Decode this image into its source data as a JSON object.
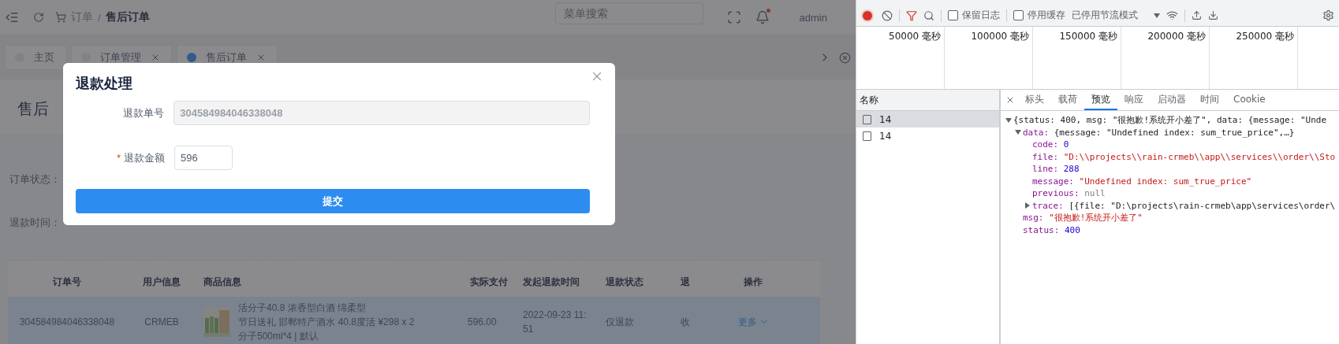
{
  "header": {
    "breadcrumb": [
      "订单",
      "售后订单"
    ],
    "breadcrumb_separator": "/",
    "search": {
      "placeholder": "菜单搜索"
    },
    "user": "admin",
    "bell_badge": true
  },
  "tabs": [
    {
      "label": "主页",
      "closable": false,
      "selected": false
    },
    {
      "label": "订单管理",
      "closable": true,
      "selected": false
    },
    {
      "label": "售后订单",
      "closable": true,
      "selected": true
    }
  ],
  "page": {
    "title": "售后",
    "filters": [
      {
        "label": "订单状态："
      },
      {
        "label": "退款时间："
      }
    ]
  },
  "table": {
    "columns": [
      "订单号",
      "用户信息",
      "商品信息",
      "实际支付",
      "发起退款时间",
      "退款状态",
      "退",
      "操作"
    ],
    "rows": [
      {
        "order_no": "304584984046338048",
        "user": "CRMEB",
        "product": {
          "kind": "picture",
          "lines": [
            "活分子40.8 浓香型白酒 绵柔型",
            "节日送礼 邯郸特产酒水 40.8度活",
            "分子500ml*4 | 默认"
          ],
          "price": "¥298 x 2"
        },
        "paid": "596.00",
        "time": "2022-09-23 11:51",
        "refund_status": "仅退款",
        "column_7": "收",
        "action": "更多",
        "selected": true
      }
    ]
  },
  "modal": {
    "title": "退款处理",
    "required_mark": "*",
    "fields": [
      {
        "label": "退款单号",
        "value": "304584984046338048",
        "disabled": true,
        "required": false
      },
      {
        "label": "退款金额",
        "value": "596",
        "disabled": false,
        "required": true
      }
    ],
    "submit": "提交"
  },
  "devtools": {
    "recording": true,
    "toolbar": {
      "preserve_log": {
        "label": "保留日志",
        "checked": false
      },
      "disable_cache": {
        "label": "停用缓存",
        "checked": false
      },
      "throttle": "已停用节流模式"
    },
    "timeline": [
      "50000 毫秒",
      "100000 毫秒",
      "150000 毫秒",
      "200000 毫秒",
      "250000 毫秒"
    ],
    "requests": {
      "header": "名称",
      "items": [
        {
          "name": "14",
          "selected": true
        },
        {
          "name": "14",
          "selected": false
        }
      ]
    },
    "detail_tabs": [
      {
        "label": "标头",
        "selected": false
      },
      {
        "label": "载荷",
        "selected": false
      },
      {
        "label": "预览",
        "selected": true
      },
      {
        "label": "响应",
        "selected": false
      },
      {
        "label": "启动器",
        "selected": false
      },
      {
        "label": "时间",
        "selected": false
      },
      {
        "label": "Cookie",
        "selected": false
      }
    ],
    "preview": [
      {
        "kind": "summary",
        "text": "{status: 400, msg: \"很抱歉!系统开小差了\", data: {message: \"Unde",
        "expanded": true,
        "children": [
          {
            "kind": "object",
            "key": "data:",
            "value": "{message: \"Undefined index: sum_true_price\",…}",
            "expanded": true,
            "children": [
              {
                "kind": "number",
                "key": "code:",
                "value": "0"
              },
              {
                "kind": "string",
                "key": "file:",
                "value": "\"D:\\\\projects\\\\rain-crmeb\\\\app\\\\services\\\\order\\\\Sto"
              },
              {
                "kind": "number",
                "key": "line:",
                "value": "288"
              },
              {
                "kind": "string",
                "key": "message:",
                "value": "\"Undefined index: sum_true_price\""
              },
              {
                "kind": "null",
                "key": "previous:",
                "value": "null"
              },
              {
                "kind": "object",
                "key": "trace:",
                "value": "[{file: \"D:\\projects\\rain-crmeb\\app\\services\\order\\",
                "expanded": false
              }
            ]
          },
          {
            "kind": "string",
            "key": "msg:",
            "value": "\"很抱歉!系统开小差了\""
          },
          {
            "kind": "number",
            "key": "status:",
            "value": "400"
          }
        ]
      }
    ]
  }
}
